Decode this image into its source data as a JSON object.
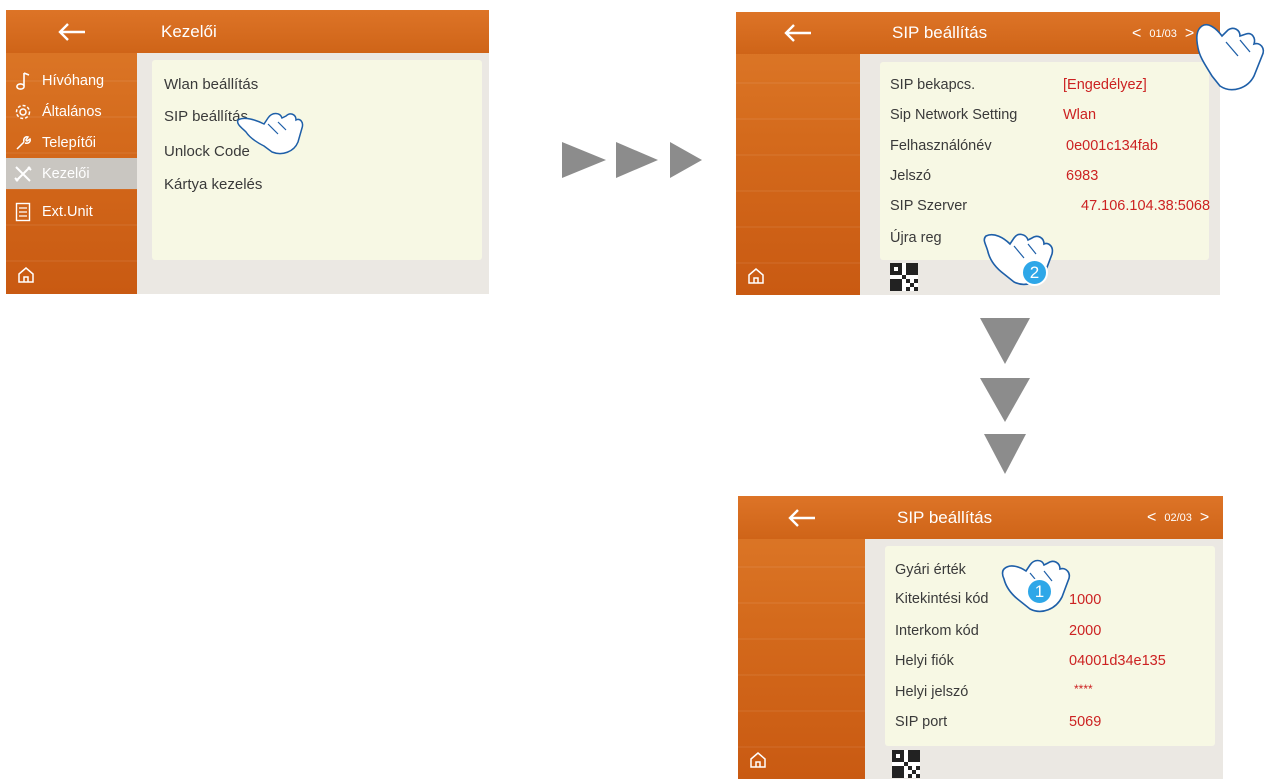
{
  "colors": {
    "accent_orange": "#d46a1c",
    "panel_bg": "#f7f8e4",
    "value_red": "#cc2222",
    "step_badge": "#2ea7e8",
    "arrow_gray": "#8c8c8c"
  },
  "screen1": {
    "title": "Kezelői",
    "back_icon": "arrow-left-icon",
    "home_icon": "home-icon",
    "sidebar": [
      {
        "label": "Hívóhang",
        "icon": "music-note-icon"
      },
      {
        "label": "Általános",
        "icon": "gear-icon"
      },
      {
        "label": "Telepítői",
        "icon": "wrench-icon"
      },
      {
        "label": "Kezelői",
        "icon": "tools-icon"
      },
      {
        "label": "Ext.Unit",
        "icon": "list-icon"
      }
    ],
    "menu": [
      "Wlan beállítás",
      "SIP beállítás",
      "Unlock Code",
      "Kártya kezelés"
    ]
  },
  "screen2": {
    "title": "SIP beállítás",
    "pager": {
      "prev": "<",
      "page": "01/03",
      "next": ">"
    },
    "rows": [
      {
        "label": "SIP bekapcs.",
        "value": "[Engedélyez]"
      },
      {
        "label": "Sip Network Setting",
        "value": "Wlan"
      },
      {
        "label": "Felhasználónév",
        "value": "0e001c134fab"
      },
      {
        "label": "Jelszó",
        "value": "6983"
      },
      {
        "label": "SIP Szerver",
        "value": "47.106.104.38:5068"
      },
      {
        "label": "Újra reg",
        "value": ""
      }
    ],
    "step_badge": "2"
  },
  "screen3": {
    "title": "SIP beállítás",
    "pager": {
      "prev": "<",
      "page": "02/03",
      "next": ">"
    },
    "rows": [
      {
        "label": "Gyári érték",
        "value": ""
      },
      {
        "label": "Kitekintési kód",
        "value": "1000"
      },
      {
        "label": "Interkom kód",
        "value": "2000"
      },
      {
        "label": "Helyi fiók",
        "value": "04001d34e135"
      },
      {
        "label": "Helyi jelszó",
        "value": "****"
      },
      {
        "label": "SIP port",
        "value": "5069"
      }
    ],
    "step_badge": "1"
  },
  "flow_arrows": {
    "right_count": 3,
    "down_count": 3
  }
}
